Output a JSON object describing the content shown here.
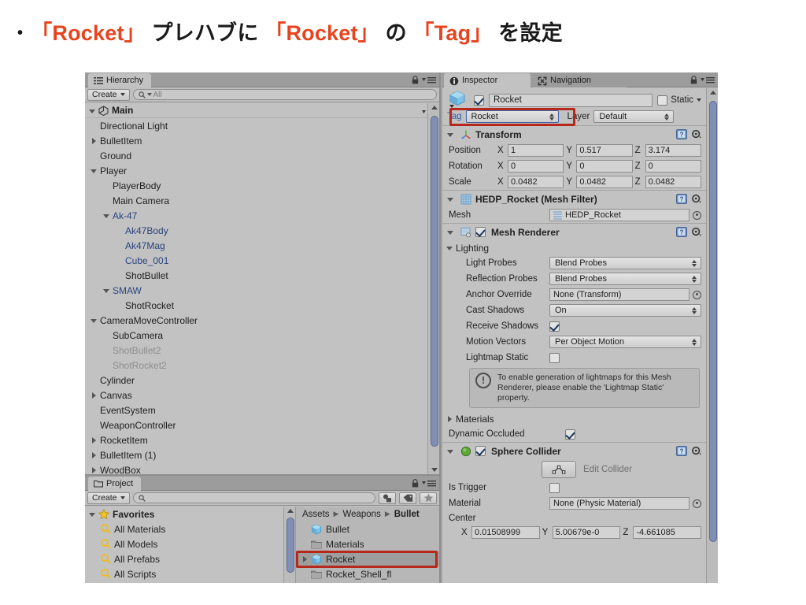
{
  "slide": {
    "bullet": "•",
    "parts": [
      {
        "text": "「Rocket」",
        "hl": true
      },
      {
        "text": " プレハブに ",
        "hl": false
      },
      {
        "text": "「Rocket」",
        "hl": true
      },
      {
        "text": " の ",
        "hl": false
      },
      {
        "text": "「Tag」",
        "hl": true
      },
      {
        "text": " を設定",
        "hl": false
      }
    ],
    "highlight_color": "#e8431f"
  },
  "hierarchy": {
    "tab_label": "Hierarchy",
    "tab_icon": "hierarchy-icon",
    "lock_icon": "lock-icon",
    "menu_icon": "panel-menu-icon",
    "create_label": "Create",
    "search_placeholder": "All",
    "search_value": "",
    "scene_name": "Main",
    "items": [
      {
        "label": "Directional Light",
        "depth": 1,
        "arrow": "none",
        "style": "normal"
      },
      {
        "label": "BulletItem",
        "depth": 1,
        "arrow": "right",
        "style": "normal"
      },
      {
        "label": "Ground",
        "depth": 1,
        "arrow": "none",
        "style": "normal"
      },
      {
        "label": "Player",
        "depth": 1,
        "arrow": "down",
        "style": "normal"
      },
      {
        "label": "PlayerBody",
        "depth": 2,
        "arrow": "none",
        "style": "normal"
      },
      {
        "label": "Main Camera",
        "depth": 2,
        "arrow": "none",
        "style": "normal"
      },
      {
        "label": "Ak-47",
        "depth": 2,
        "arrow": "down",
        "style": "prefab"
      },
      {
        "label": "Ak47Body",
        "depth": 3,
        "arrow": "none",
        "style": "prefab"
      },
      {
        "label": "Ak47Mag",
        "depth": 3,
        "arrow": "none",
        "style": "prefab"
      },
      {
        "label": "Cube_001",
        "depth": 3,
        "arrow": "none",
        "style": "prefab"
      },
      {
        "label": "ShotBullet",
        "depth": 3,
        "arrow": "none",
        "style": "normal"
      },
      {
        "label": "SMAW",
        "depth": 2,
        "arrow": "down",
        "style": "prefab"
      },
      {
        "label": "ShotRocket",
        "depth": 3,
        "arrow": "none",
        "style": "normal"
      },
      {
        "label": "CameraMoveController",
        "depth": 1,
        "arrow": "down",
        "style": "normal"
      },
      {
        "label": "SubCamera",
        "depth": 2,
        "arrow": "none",
        "style": "normal"
      },
      {
        "label": "ShotBullet2",
        "depth": 2,
        "arrow": "none",
        "style": "inactive"
      },
      {
        "label": "ShotRocket2",
        "depth": 2,
        "arrow": "none",
        "style": "inactive"
      },
      {
        "label": "Cylinder",
        "depth": 1,
        "arrow": "none",
        "style": "normal"
      },
      {
        "label": "Canvas",
        "depth": 1,
        "arrow": "right",
        "style": "normal"
      },
      {
        "label": "EventSystem",
        "depth": 1,
        "arrow": "none",
        "style": "normal"
      },
      {
        "label": "WeaponController",
        "depth": 1,
        "arrow": "none",
        "style": "normal"
      },
      {
        "label": "RocketItem",
        "depth": 1,
        "arrow": "right",
        "style": "normal"
      },
      {
        "label": "BulletItem (1)",
        "depth": 1,
        "arrow": "right",
        "style": "normal"
      },
      {
        "label": "WoodBox",
        "depth": 1,
        "arrow": "right",
        "style": "normal"
      }
    ]
  },
  "project": {
    "tab_label": "Project",
    "tab_icon": "folder-icon",
    "lock_icon": "lock-icon",
    "menu_icon": "panel-menu-icon",
    "create_label": "Create",
    "search_placeholder": "",
    "search_value": "",
    "toolbar_icons": [
      "filter-by-type-icon",
      "filter-by-label-icon",
      "favorites-star-icon"
    ],
    "favorites": {
      "label": "Favorites",
      "items": [
        "All Materials",
        "All Models",
        "All Prefabs",
        "All Scripts"
      ]
    },
    "breadcrumb": [
      "Assets",
      "Weapons",
      "Bullet"
    ],
    "files": [
      {
        "label": "Bullet",
        "icon": "prefab-icon",
        "arrow": "none",
        "selected": false
      },
      {
        "label": "Materials",
        "icon": "folder-icon",
        "arrow": "none",
        "selected": false
      },
      {
        "label": "Rocket",
        "icon": "prefab-icon",
        "arrow": "right",
        "selected": true
      },
      {
        "label": "Rocket_Shell_fl",
        "icon": "folder-icon",
        "arrow": "none",
        "selected": false
      }
    ]
  },
  "inspector": {
    "tabs": [
      {
        "label": "Inspector",
        "icon": "info-icon",
        "active": true
      },
      {
        "label": "Navigation",
        "icon": "navigation-icon",
        "active": false
      }
    ],
    "lock_icon": "lock-icon",
    "menu_icon": "panel-menu-icon",
    "object": {
      "icon": "prefab-cube-icon",
      "enabled": true,
      "name": "Rocket",
      "static_label": "Static",
      "static_checked": false,
      "tag_label": "Tag",
      "tag_value": "Rocket",
      "layer_label": "Layer",
      "layer_value": "Default",
      "tag_highlight_color": "#b5281b"
    },
    "transform": {
      "title": "Transform",
      "icon": "transform-axis-icon",
      "rows": [
        {
          "label": "Position",
          "x": "1",
          "y": "0.517",
          "z": "3.174"
        },
        {
          "label": "Rotation",
          "x": "0",
          "y": "0",
          "z": "0"
        },
        {
          "label": "Scale",
          "x": "0.0482",
          "y": "0.0482",
          "z": "0.0482"
        }
      ]
    },
    "mesh_filter": {
      "title": "HEDP_Rocket (Mesh Filter)",
      "icon": "mesh-filter-icon",
      "mesh_label": "Mesh",
      "mesh_value": "HEDP_Rocket"
    },
    "mesh_renderer": {
      "title": "Mesh Renderer",
      "icon": "mesh-renderer-icon",
      "enabled": true,
      "lighting_label": "Lighting",
      "fields": [
        {
          "label": "Light Probes",
          "value": "Blend Probes",
          "type": "popup"
        },
        {
          "label": "Reflection Probes",
          "value": "Blend Probes",
          "type": "popup"
        },
        {
          "label": "Anchor Override",
          "value": "None (Transform)",
          "type": "object"
        },
        {
          "label": "Cast Shadows",
          "value": "On",
          "type": "popup"
        },
        {
          "label": "Receive Shadows",
          "value": "",
          "type": "checkbox",
          "checked": true
        },
        {
          "label": "Motion Vectors",
          "value": "Per Object Motion",
          "type": "popup"
        },
        {
          "label": "Lightmap Static",
          "value": "",
          "type": "checkbox",
          "checked": false
        }
      ],
      "info_icon": "warning-icon",
      "info_text": "To enable generation of lightmaps for this Mesh Renderer, please enable the 'Lightmap Static' property.",
      "materials_label": "Materials",
      "dynamic_occluded_label": "Dynamic Occluded",
      "dynamic_occluded_checked": true
    },
    "sphere_collider": {
      "title": "Sphere Collider",
      "icon": "collider-icon",
      "enabled": true,
      "edit_collider_icon": "edit-collider-icon",
      "edit_collider_label": "Edit Collider",
      "is_trigger_label": "Is Trigger",
      "is_trigger_checked": false,
      "material_label": "Material",
      "material_value": "None (Physic Material)",
      "center_label": "Center",
      "center": {
        "x": "0.01508999",
        "y": "5.00679e-0",
        "z": "-4.661085"
      }
    }
  }
}
